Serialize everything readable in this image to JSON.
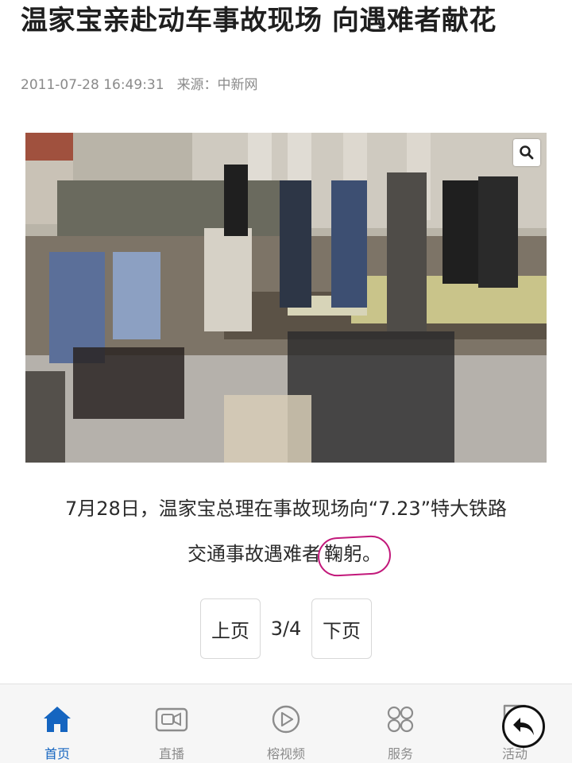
{
  "article": {
    "headline": "温家宝亲赴动车事故现场 向遇难者献花",
    "timestamp": "2011-07-28 16:49:31",
    "source": "来源：中新网",
    "caption_line1": "7月28日，温家宝总理在事故现场向“7.23”特大铁路",
    "caption_line2_pre": "交通事故遇难者",
    "caption_line2_circled": "鞠躬。"
  },
  "photo": {
    "zoom_icon": "search-icon"
  },
  "pager": {
    "prev_label": "上页",
    "count": "3/4",
    "next_label": "下页"
  },
  "tabbar": {
    "items": [
      {
        "label": "首页",
        "icon": "home-icon",
        "active": true
      },
      {
        "label": "直播",
        "icon": "video-camera-icon",
        "active": false
      },
      {
        "label": "榕视频",
        "icon": "play-icon",
        "active": false
      },
      {
        "label": "服务",
        "icon": "grid-icon",
        "active": false
      },
      {
        "label": "活动",
        "icon": "star-bookmark-icon",
        "active": false
      }
    ]
  },
  "colors": {
    "accent": "#1565c0",
    "annotation": "#c2187a",
    "inactive_tab": "#8c8c8c"
  }
}
